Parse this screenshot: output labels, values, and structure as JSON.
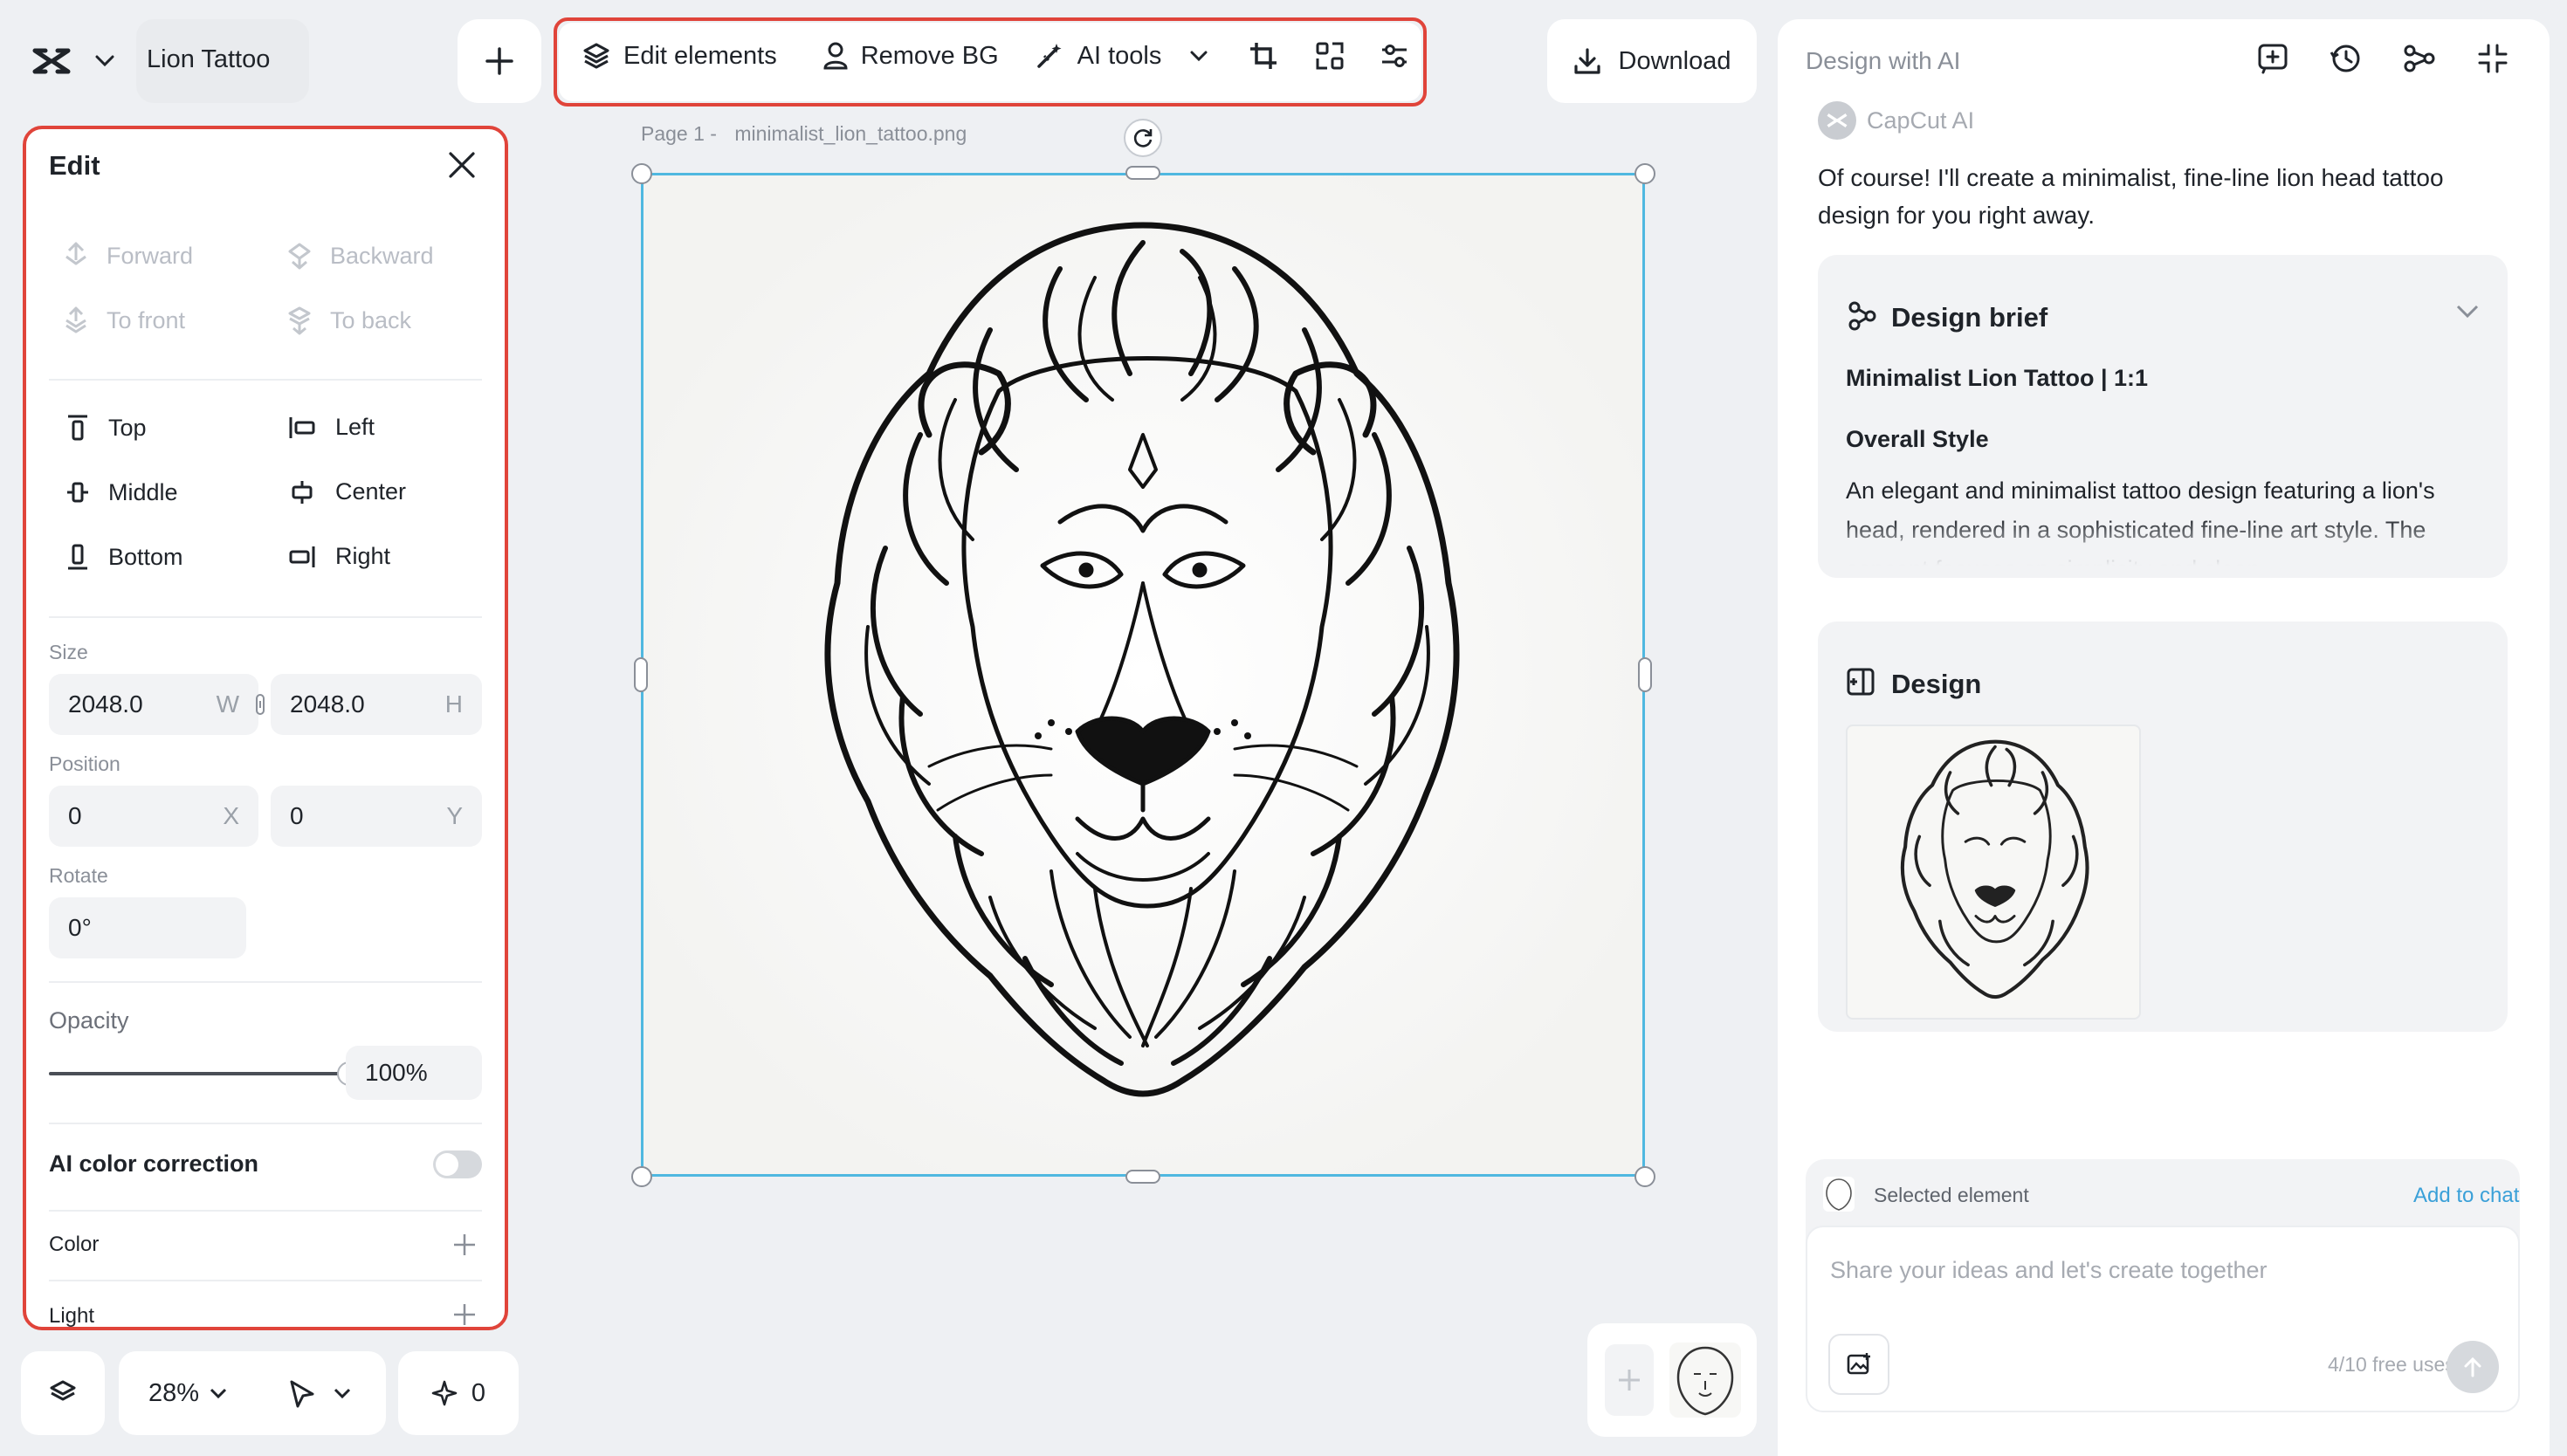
{
  "header": {
    "project_name": "Lion Tattoo",
    "add_label": "+",
    "toolbar": {
      "edit_elements": "Edit elements",
      "remove_bg": "Remove BG",
      "ai_tools": "AI tools"
    },
    "download": "Download"
  },
  "edit_panel": {
    "title": "Edit",
    "arrange": {
      "forward": "Forward",
      "backward": "Backward",
      "to_front": "To front",
      "to_back": "To back"
    },
    "align": {
      "top": "Top",
      "left": "Left",
      "middle": "Middle",
      "center": "Center",
      "bottom": "Bottom",
      "right": "Right"
    },
    "size": {
      "label": "Size",
      "w": "2048.0",
      "w_suffix": "W",
      "h": "2048.0",
      "h_suffix": "H"
    },
    "position": {
      "label": "Position",
      "x": "0",
      "x_suffix": "X",
      "y": "0",
      "y_suffix": "Y"
    },
    "rotate": {
      "label": "Rotate",
      "value": "0°"
    },
    "opacity": {
      "label": "Opacity",
      "value": "100%",
      "level": 1.0
    },
    "ai_color_correction": {
      "label": "AI color correction",
      "enabled": false
    },
    "color_label": "Color",
    "light_label": "Light"
  },
  "canvas": {
    "page_label": "Page 1 -",
    "file_name": "minimalist_lion_tattoo.png"
  },
  "bottom_bar": {
    "zoom": "28%",
    "points": "0"
  },
  "ai_panel": {
    "title": "Design with AI",
    "author": "CapCut AI",
    "message": "Of course! I'll create a minimalist, fine-line lion head tattoo design for you right away.",
    "brief": {
      "title": "Design brief",
      "subtitle": "Minimalist Lion Tattoo | 1:1",
      "style_heading": "Overall Style",
      "style_text": "An elegant and minimalist tattoo design featuring a lion's head, rendered in a sophisticated fine-line art style. The concept focuses on simplicity and clean"
    },
    "design": {
      "title": "Design"
    },
    "selected_element": "Selected element",
    "add_to_chat": "Add to chat",
    "input_placeholder": "Share your ideas and let's create together",
    "free_uses": "4/10 free uses"
  },
  "colors": {
    "accent_red": "#e0443a",
    "selection_blue": "#4fb8e0",
    "link_blue": "#3aa0d8"
  }
}
